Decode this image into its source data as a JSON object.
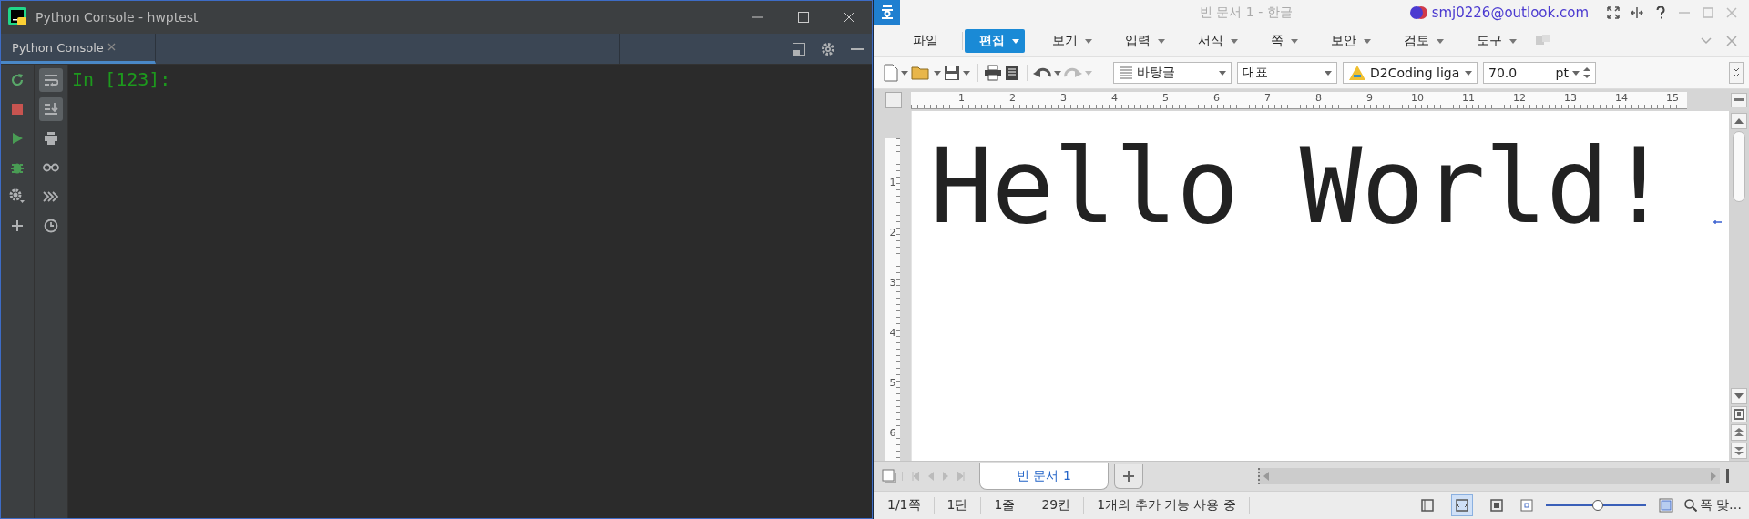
{
  "pycharm": {
    "title": "Python Console - hwptest",
    "tabs": [
      {
        "label": "Python Console",
        "selected": true
      }
    ],
    "run_tools": [
      {
        "kind": "rerun"
      },
      {
        "kind": "stop"
      },
      {
        "kind": "run"
      },
      {
        "kind": "debug"
      },
      {
        "kind": "settings"
      },
      {
        "kind": "add"
      }
    ],
    "view_tools": [
      {
        "kind": "soft-wrap",
        "on": true
      },
      {
        "kind": "scroll-end",
        "on": true
      },
      {
        "kind": "print",
        "on": false
      },
      {
        "kind": "glasses",
        "on": false
      },
      {
        "kind": "forward",
        "on": false
      },
      {
        "kind": "history",
        "on": false
      }
    ],
    "prompt": "In [123]:"
  },
  "hwp": {
    "title": "빈 문서 1 - 한글",
    "account": "smj0226@outlook.com",
    "menus": [
      {
        "label": "파일",
        "selected": false,
        "dropdown": false
      },
      {
        "label": "편집",
        "selected": true,
        "dropdown": true
      },
      {
        "label": "보기",
        "selected": false,
        "dropdown": true
      },
      {
        "label": "입력",
        "selected": false,
        "dropdown": true
      },
      {
        "label": "서식",
        "selected": false,
        "dropdown": true
      },
      {
        "label": "쪽",
        "selected": false,
        "dropdown": true
      },
      {
        "label": "보안",
        "selected": false,
        "dropdown": true
      },
      {
        "label": "검토",
        "selected": false,
        "dropdown": true
      },
      {
        "label": "도구",
        "selected": false,
        "dropdown": true
      }
    ],
    "toolbar": {
      "style": "바탕글",
      "language": "대표",
      "font": "D2Coding liga",
      "size": "70.0",
      "unit": "pt"
    },
    "ruler_h": [
      "1",
      "2",
      "3",
      "4",
      "5",
      "6",
      "7",
      "8",
      "9",
      "10",
      "11",
      "12",
      "13",
      "14",
      "15"
    ],
    "ruler_v": [
      "1",
      "2",
      "3",
      "4",
      "5",
      "6"
    ],
    "document_text": "Hello World!",
    "doc_tabs": [
      {
        "label": "빈 문서 1",
        "selected": true
      }
    ],
    "status": [
      "1/1쪽",
      "1단",
      "1줄",
      "29칸",
      "1개의 추가 기능 사용 중"
    ],
    "view_modes": [
      {
        "selected": false
      },
      {
        "selected": true
      },
      {
        "selected": false
      }
    ],
    "zoom": {
      "level": 0.52,
      "label": "폭 맞…"
    }
  }
}
